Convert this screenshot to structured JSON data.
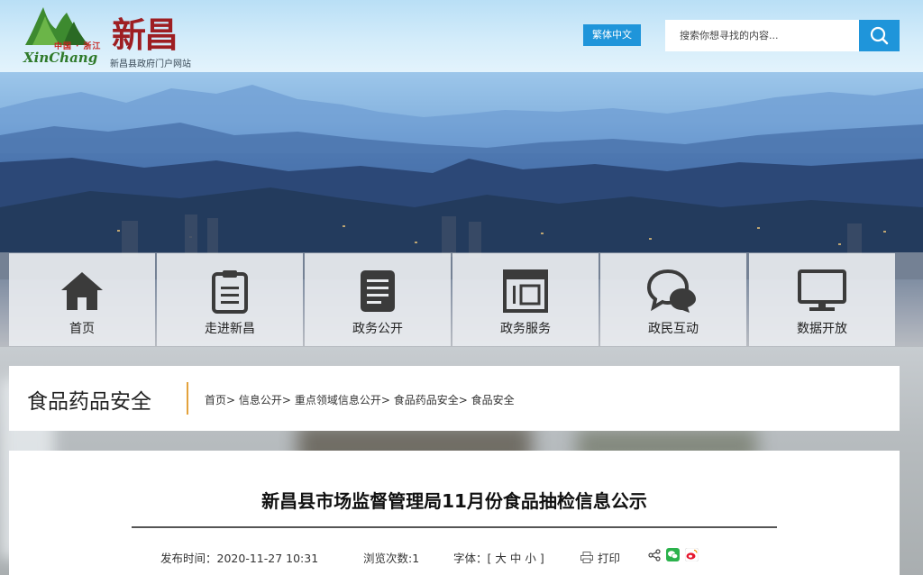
{
  "header": {
    "logo": {
      "small_text": "中国 · 浙江",
      "en_text": "XinChang",
      "big_text": "新昌",
      "subtitle": "新昌县政府门户网站"
    },
    "lang_toggle": "繁体中文",
    "search": {
      "placeholder": "搜索你想寻找的内容...",
      "button_icon": "search-icon"
    }
  },
  "nav": [
    {
      "label": "首页",
      "icon": "home-icon"
    },
    {
      "label": "走进新昌",
      "icon": "clipboard-icon"
    },
    {
      "label": "政务公开",
      "icon": "document-icon"
    },
    {
      "label": "政务服务",
      "icon": "service-icon"
    },
    {
      "label": "政民互动",
      "icon": "chat-icon"
    },
    {
      "label": "数据开放",
      "icon": "monitor-icon"
    }
  ],
  "section": {
    "title": "食品药品安全",
    "breadcrumb": [
      "首页",
      "信息公开",
      "重点领域信息公开",
      "食品药品安全",
      "食品安全"
    ],
    "separator": ">"
  },
  "article": {
    "title": "新昌县市场监督管理局11月份食品抽检信息公示",
    "publish_label": "发布时间：",
    "publish_time": "2020-11-27 10:31",
    "views_label": "浏览次数:",
    "views": "1",
    "font_label": "字体：",
    "font_open": "[",
    "font_large": "大",
    "font_medium": "中",
    "font_small": "小",
    "font_close": "]",
    "print_label": "打印",
    "share_icons": [
      "share-icon",
      "wechat-icon",
      "weibo-icon"
    ]
  },
  "colors": {
    "accent_blue": "#1f95da",
    "divider_orange": "#e3a23c",
    "logo_red": "#9e1e22",
    "logo_green": "#2f7a2a"
  }
}
